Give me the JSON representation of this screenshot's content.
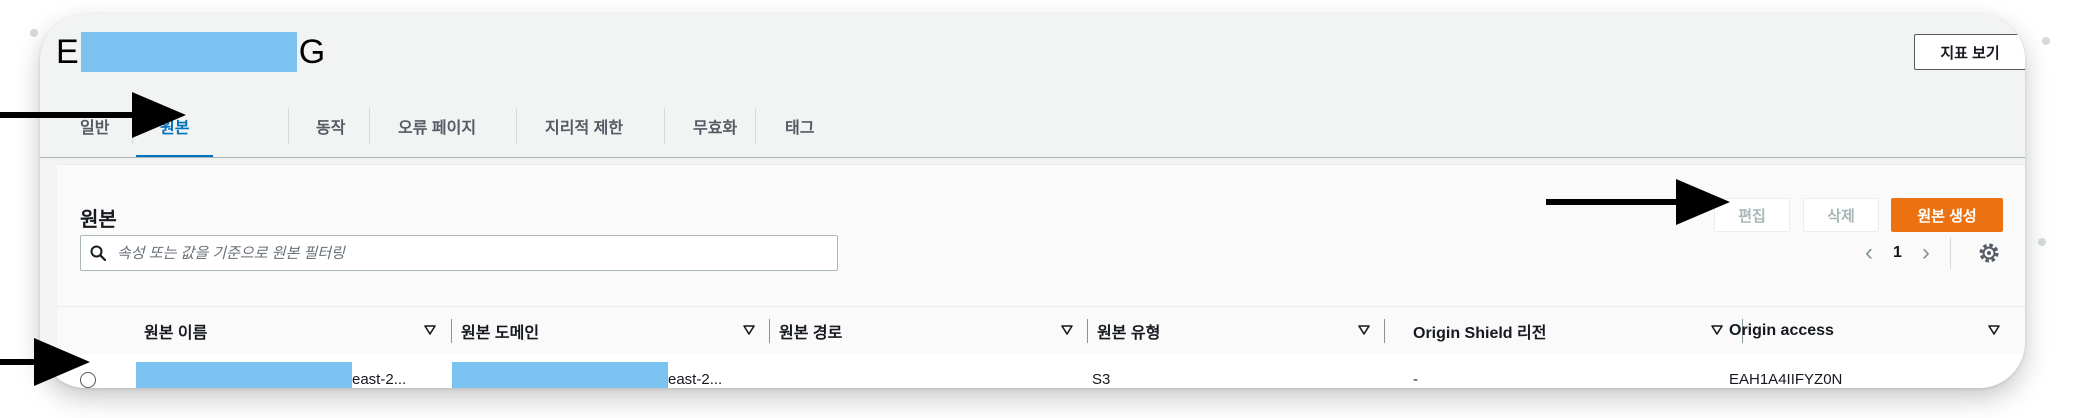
{
  "header": {
    "title_prefix": "E",
    "title_suffix": "G",
    "metrics_button": "지표 보기"
  },
  "tabs": [
    {
      "label": "일반",
      "active": false
    },
    {
      "label": "원본",
      "active": true
    },
    {
      "label": "동작",
      "active": false
    },
    {
      "label": "오류 페이지",
      "active": false
    },
    {
      "label": "지리적 제한",
      "active": false
    },
    {
      "label": "무효화",
      "active": false
    },
    {
      "label": "태그",
      "active": false
    }
  ],
  "panel": {
    "title": "원본",
    "edit_button": "편집",
    "delete_button": "삭제",
    "create_button": "원본 생성",
    "search_placeholder": "속성 또는 값을 기준으로 원본 필터링",
    "page_number": "1"
  },
  "table": {
    "columns": [
      "원본 이름",
      "원본 도메인",
      "원본 경로",
      "원본 유형",
      "Origin Shield 리전",
      "Origin access"
    ],
    "rows": [
      {
        "name_suffix": "east-2...",
        "domain_suffix": "east-2...",
        "path": "",
        "type": "S3",
        "shield_region": "-",
        "access": "EAH1A4IIFYZ0N"
      }
    ]
  },
  "colors": {
    "accent": "#0073bb",
    "primary_button": "#ec7211",
    "redaction": "#7cc2f0"
  },
  "icons": [
    "search-icon",
    "chevron-left-icon",
    "chevron-right-icon",
    "gear-icon",
    "sort-down-icon",
    "arrow-right-icon"
  ]
}
